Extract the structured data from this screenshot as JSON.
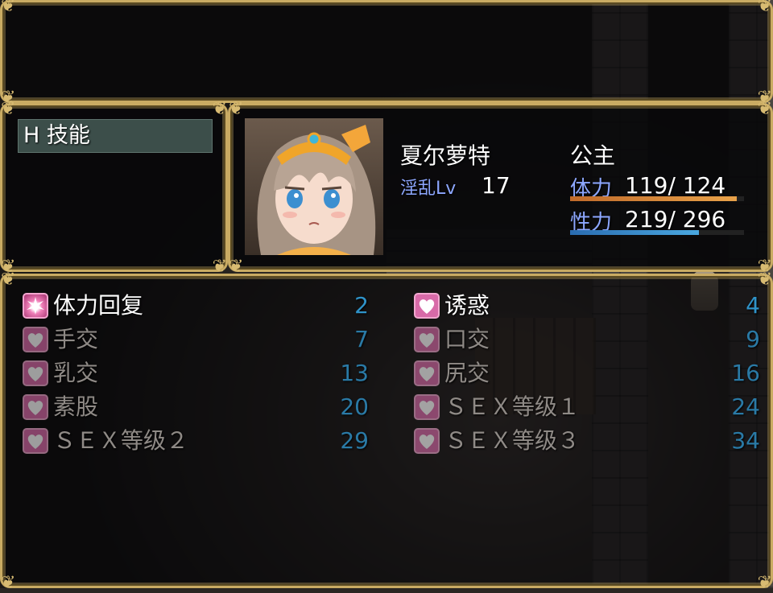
{
  "help": {
    "text": ""
  },
  "category": {
    "label": "H 技能"
  },
  "actor": {
    "name": "夏尔萝特",
    "title": "公主",
    "level_label": "淫乱Lv",
    "level": "17",
    "hp": {
      "label": "体力",
      "value": "119/  124",
      "current": 119,
      "max": 124,
      "color": "#e8a24a"
    },
    "sp": {
      "label": "性力",
      "value": "219/  296",
      "current": 219,
      "max": 296,
      "color": "#4aa8e0"
    }
  },
  "skills": [
    {
      "name": "体力回复",
      "cost": "2",
      "enabled": true,
      "icon": "heal-burst-icon"
    },
    {
      "name": "诱惑",
      "cost": "4",
      "enabled": true,
      "icon": "heart-icon"
    },
    {
      "name": "手交",
      "cost": "7",
      "enabled": false,
      "icon": "heart-icon"
    },
    {
      "name": "口交",
      "cost": "9",
      "enabled": false,
      "icon": "heart-icon"
    },
    {
      "name": "乳交",
      "cost": "13",
      "enabled": false,
      "icon": "heart-icon"
    },
    {
      "name": "尻交",
      "cost": "16",
      "enabled": false,
      "icon": "heart-icon"
    },
    {
      "name": "素股",
      "cost": "20",
      "enabled": false,
      "icon": "heart-icon"
    },
    {
      "name": "ＳＥＸ等级１",
      "cost": "24",
      "enabled": false,
      "icon": "heart-icon"
    },
    {
      "name": "ＳＥＸ等级２",
      "cost": "29",
      "enabled": false,
      "icon": "heart-icon"
    },
    {
      "name": "ＳＥＸ等级３",
      "cost": "34",
      "enabled": false,
      "icon": "heart-icon"
    }
  ],
  "colors": {
    "frame": "#c9ab63",
    "cost": "#2f93c9",
    "highlight": "#3c4e4a"
  }
}
